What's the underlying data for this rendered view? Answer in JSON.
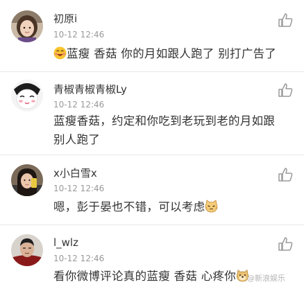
{
  "comments": [
    {
      "username": "初原i",
      "time": "10-12 12:46",
      "text": "蓝瘦 香菇 你的月如跟人跑了 别打广告了"
    },
    {
      "username": "青椒青椒青椒Ly",
      "time": "10-12 12:46",
      "text_line1": "蓝瘦香菇，约定和你吃到老玩到老的月如跟",
      "text_line2": "别人跑了"
    },
    {
      "username": "x小白雪x",
      "time": "10-12 12:46",
      "text": "嗯，彭于晏也不错，可以考虑"
    },
    {
      "username": "l_wlz",
      "time": "10-12 12:46",
      "text": "看你微博评论真的蓝瘦 香菇 心疼你"
    }
  ],
  "watermark": "@新浪娱乐",
  "icons": {
    "like": "thumbs-up-icon",
    "emoji_1": "laughing-face-emoji",
    "emoji_3": "cat-face-emoji",
    "emoji_4": "doge-emoji"
  },
  "colors": {
    "username": "#333333",
    "timestamp": "#999999",
    "body_text": "#333333",
    "divider": "#e8e8e8",
    "like_icon": "#9a9a9a"
  }
}
